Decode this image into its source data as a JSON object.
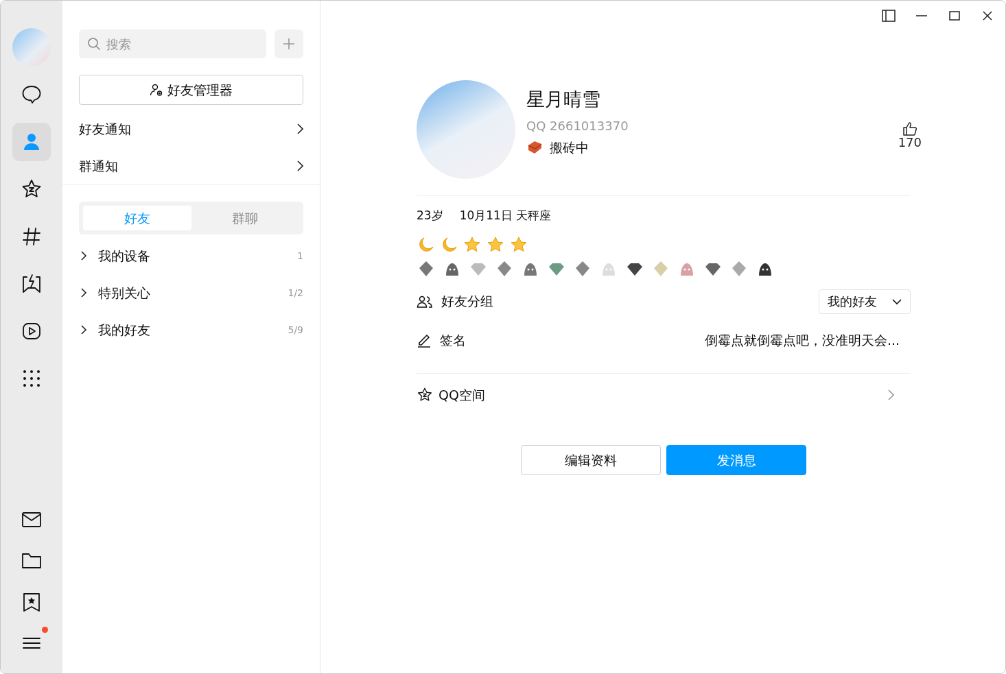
{
  "rail": {
    "items": [
      {
        "kind": "chat",
        "selected": false
      },
      {
        "kind": "contacts",
        "selected": true
      },
      {
        "kind": "qzone",
        "selected": false
      },
      {
        "kind": "channel",
        "selected": false
      },
      {
        "kind": "games",
        "selected": false
      },
      {
        "kind": "video",
        "selected": false
      },
      {
        "kind": "apps",
        "selected": false
      }
    ],
    "bottom": [
      {
        "kind": "mail",
        "dot": false
      },
      {
        "kind": "folder",
        "dot": false
      },
      {
        "kind": "bookmark",
        "dot": false
      },
      {
        "kind": "menu",
        "dot": true
      }
    ]
  },
  "search": {
    "placeholder": "搜索"
  },
  "manager_button": "好友管理器",
  "notices": [
    "好友通知",
    "群通知"
  ],
  "tabs": [
    {
      "label": "好友",
      "selected": true
    },
    {
      "label": "群聊",
      "selected": false
    }
  ],
  "groups": [
    {
      "name": "我的设备",
      "count": "1",
      "expanded": false
    },
    {
      "name": "特别关心",
      "count": "1/2",
      "expanded": false
    },
    {
      "name": "我的好友",
      "count": "5/9",
      "expanded": false
    }
  ],
  "profile": {
    "name": "星月晴雪",
    "qq": "QQ 2661013370",
    "status": "搬砖中",
    "likes": "170",
    "age": "23岁",
    "birthday": "10月11日 天秤座",
    "group_label": "好友分组",
    "group_value": "我的好友",
    "signature_label": "签名",
    "signature": "倒霉点就倒霉点吧，没准明天会...",
    "qzone": "QQ空间",
    "buttons": [
      {
        "label": "编辑资料",
        "primary": false
      },
      {
        "label": "发消息",
        "primary": true
      }
    ]
  }
}
